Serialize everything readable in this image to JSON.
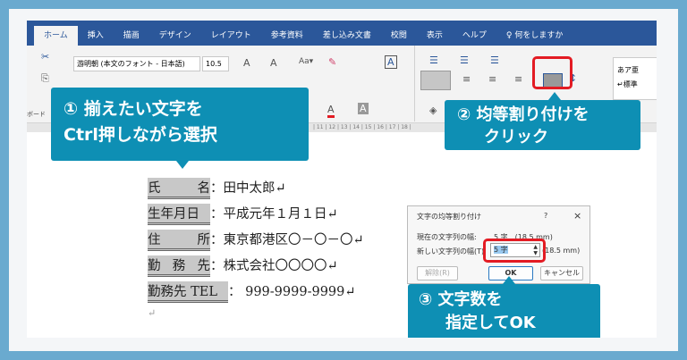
{
  "ribbon": {
    "tabs": [
      "ホーム",
      "挿入",
      "描画",
      "デザイン",
      "レイアウト",
      "参考資料",
      "差し込み文書",
      "校閲",
      "表示",
      "ヘルプ"
    ],
    "search": "何をしますか",
    "font_name": "游明朝 (本文のフォント - 日本語)",
    "font_size": "10.5",
    "clipboard": "ボード",
    "style_preview": "あア亜",
    "style_label": "↵標準"
  },
  "ruler": "| 11 | 12 | 13 | 14 | 15 | 16 | 17 | 18 |",
  "document": {
    "rows": [
      {
        "label": "氏　　名",
        "value": "：田中太郎↵"
      },
      {
        "label": "生年月日",
        "value": "：平成元年１月１日↵"
      },
      {
        "label": "住　　所",
        "value": "：東京都港区〇－〇－〇↵"
      },
      {
        "label": "勤 務 先",
        "value": "：株式会社〇〇〇〇↵"
      },
      {
        "label": "勤務先 TEL",
        "value": "：  999-9999-9999↵"
      }
    ],
    "empty_mark": "↵"
  },
  "dialog": {
    "title": "文字の均等割り付け",
    "help": "?",
    "close": "×",
    "current_label": "現在の文字列の幅:",
    "current_value": "5 字　(18.5 mm)",
    "new_label": "新しい文字列の幅(T):",
    "new_value": "5 字",
    "new_mm": "(18.5 mm)",
    "clear": "解除(R)",
    "ok": "OK",
    "cancel": "キャンセル"
  },
  "callouts": {
    "c1_line1": "① 揃えたい文字を",
    "c1_line2": "Ctrl押しながら選択",
    "c2_line1": "② 均等割り付けを",
    "c2_line2": "クリック",
    "c3_line1": "③ 文字数を",
    "c3_line2": "指定してOK"
  },
  "colors": {
    "callout": "#0e8fb4",
    "highlight": "#e31b23",
    "ribbon_bar": "#2b579a"
  }
}
